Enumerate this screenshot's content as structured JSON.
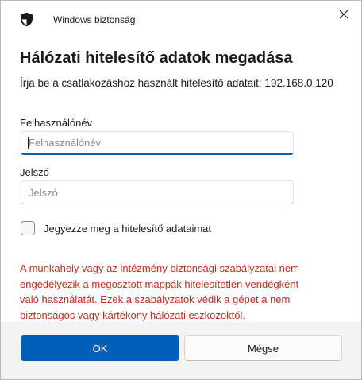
{
  "window": {
    "title": "Windows biztonság",
    "close_icon": "close-icon",
    "app_icon": "shield-icon"
  },
  "dialog": {
    "heading": "Hálózati hitelesítő adatok megadása",
    "instruction": "Írja be a csatlakozáshoz használt hitelesítő adatait: 192.168.0.120"
  },
  "username": {
    "label": "Felhasználónév",
    "placeholder": "Felhasználónév",
    "value": ""
  },
  "password": {
    "label": "Jelszó",
    "placeholder": "Jelszó",
    "value": ""
  },
  "remember": {
    "label": "Jegyezze meg a hitelesítő adataimat",
    "checked": false
  },
  "warning": {
    "lines": [
      "A munkahely vagy az intézmény biztonsági szabályzatai nem",
      "engedélyezik a megosztott mappák hitelesítetlen vendégként",
      "való használatát. Ezek a szabályzatok védik a gépet a nem",
      "biztonságos vagy kártékony hálózati eszközöktől."
    ]
  },
  "buttons": {
    "ok": "OK",
    "cancel": "Mégse"
  },
  "colors": {
    "accent": "#005fb8",
    "warning": "#c42b1c",
    "footer_background": "#f3f3f3"
  }
}
